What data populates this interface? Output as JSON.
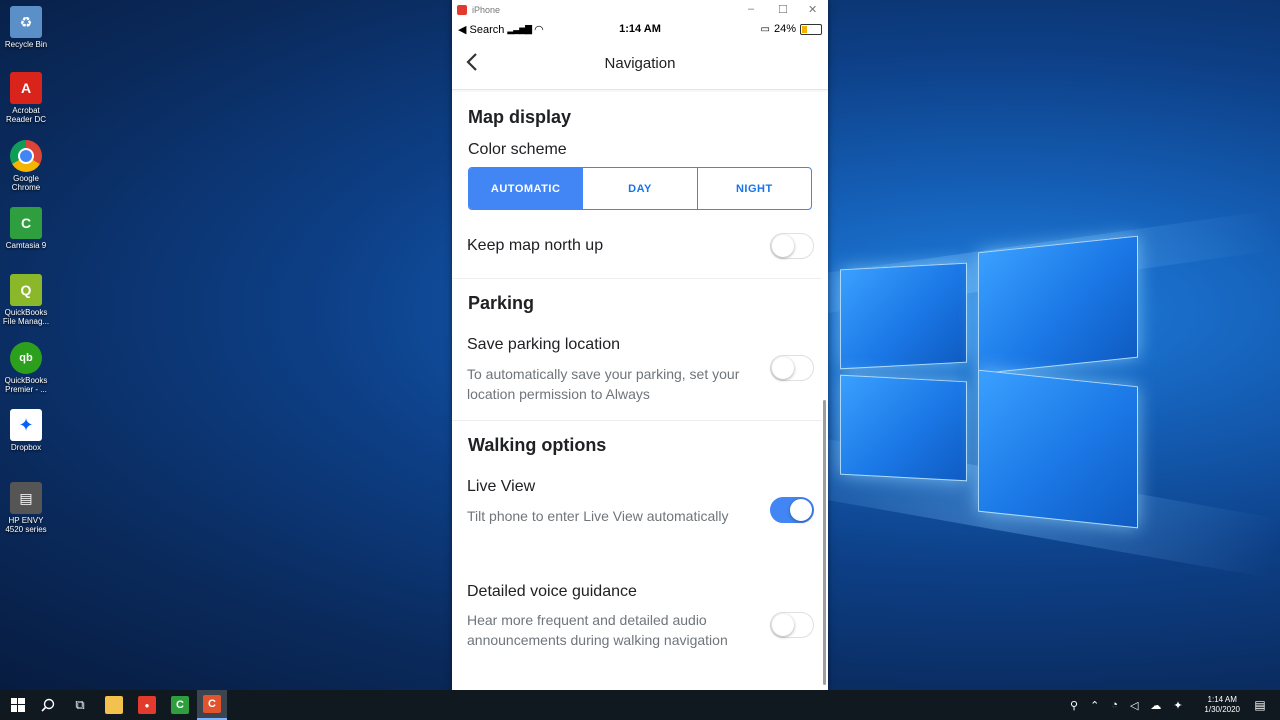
{
  "desktop": {
    "icons": [
      {
        "label": "Recycle Bin",
        "color": "#5b8fc7",
        "glyph": "♻"
      },
      {
        "label": "Acrobat Reader DC",
        "color": "#d9241c",
        "glyph": "A"
      },
      {
        "label": "Google Chrome",
        "color": "#e8eaed",
        "glyph": "◉"
      },
      {
        "label": "Camtasia 9",
        "color": "#2e9e3f",
        "glyph": "C"
      },
      {
        "label": "QuickBooks File Manag...",
        "color": "#8ab82a",
        "glyph": "Q"
      },
      {
        "label": "QuickBooks Premier - ...",
        "color": "#2ca01c",
        "glyph": "qb"
      },
      {
        "label": "Dropbox",
        "color": "#ffffff",
        "glyph": "✦"
      },
      {
        "label": "HP ENVY 4520 series",
        "color": "#555555",
        "glyph": "▤"
      }
    ]
  },
  "window": {
    "title": "iPhone",
    "minimize": "–",
    "maximize": "☐",
    "close": "✕"
  },
  "status": {
    "back_app": "◀ Search",
    "time": "1:14 AM",
    "battery": "24%"
  },
  "nav": {
    "back": "‹",
    "title": "Navigation"
  },
  "map_display": {
    "heading": "Map display",
    "color_scheme_label": "Color scheme",
    "options": [
      "AUTOMATIC",
      "DAY",
      "NIGHT"
    ],
    "selected": "AUTOMATIC",
    "north_up_label": "Keep map north up",
    "north_up_on": false
  },
  "parking": {
    "heading": "Parking",
    "save_label": "Save parking location",
    "save_sub": "To automatically save your parking, set your location permission to Always",
    "save_on": false
  },
  "walking": {
    "heading": "Walking options",
    "live_view_label": "Live View",
    "live_view_sub": "Tilt phone to enter Live View automatically",
    "live_view_on": true,
    "voice_label": "Detailed voice guidance",
    "voice_sub": "Hear more frequent and detailed audio announcements during walking navigation",
    "voice_on": false
  },
  "taskbar": {
    "clock_time": "1:14 AM",
    "clock_date": "1/30/2020",
    "accent": "#4285f4"
  }
}
